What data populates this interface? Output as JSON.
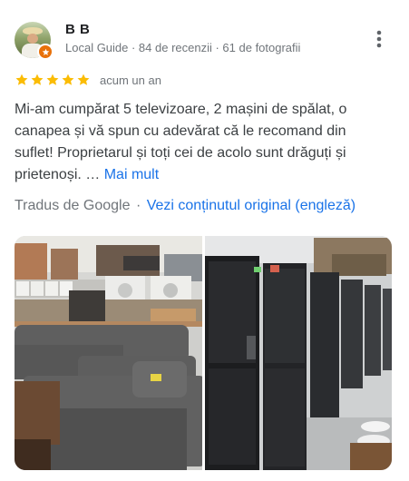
{
  "review": {
    "author": {
      "name": "B B",
      "avatar_icon": "user-avatar-photo",
      "badge_icon": "local-guide-star-icon",
      "badge_color": "#e8710a",
      "meta": "Local Guide · 84 de recenzii · 61 de fotografii"
    },
    "menu_icon": "more-vert-icon",
    "rating": {
      "stars": 5,
      "max": 5,
      "star_color": "#fbbc04"
    },
    "date": "acum un an",
    "text": "Mi-am cumpărat 5 televizoare, 2 mașini de spălat, o canapea și vă spun cu adevărat că le recomand din suflet! Proprietarul și toți cei de acolo sunt drăguți și prietenoși. …",
    "more_label": "Mai mult",
    "translated_by": "Tradus de Google",
    "separator": "·",
    "original_link": "Vezi conținutul original (engleză)",
    "link_color": "#1a73e8",
    "photos": [
      {
        "icon": "store-photo-sofa"
      },
      {
        "icon": "store-photo-fridges"
      }
    ]
  }
}
